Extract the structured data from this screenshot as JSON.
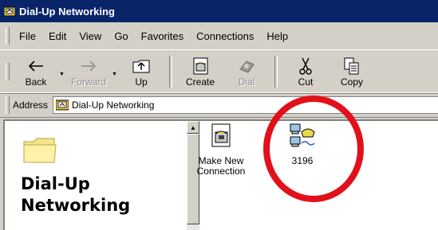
{
  "window": {
    "title": "Dial-Up Networking"
  },
  "menu": [
    "File",
    "Edit",
    "View",
    "Go",
    "Favorites",
    "Connections",
    "Help"
  ],
  "toolbar": {
    "back": "Back",
    "forward": "Forward",
    "up": "Up",
    "create": "Create",
    "dial": "Dial",
    "cut": "Cut",
    "copy": "Copy"
  },
  "address": {
    "label": "Address",
    "value": "Dial-Up Networking"
  },
  "left_pane": {
    "title_line1": "Dial-Up",
    "title_line2": "Networking"
  },
  "items": [
    {
      "label_line1": "Make New",
      "label_line2": "Connection"
    },
    {
      "label_line1": "3196"
    }
  ],
  "colors": {
    "titlebar": "#0a246a",
    "highlight_circle": "#e2101a",
    "chrome": "#d4d0c8"
  }
}
